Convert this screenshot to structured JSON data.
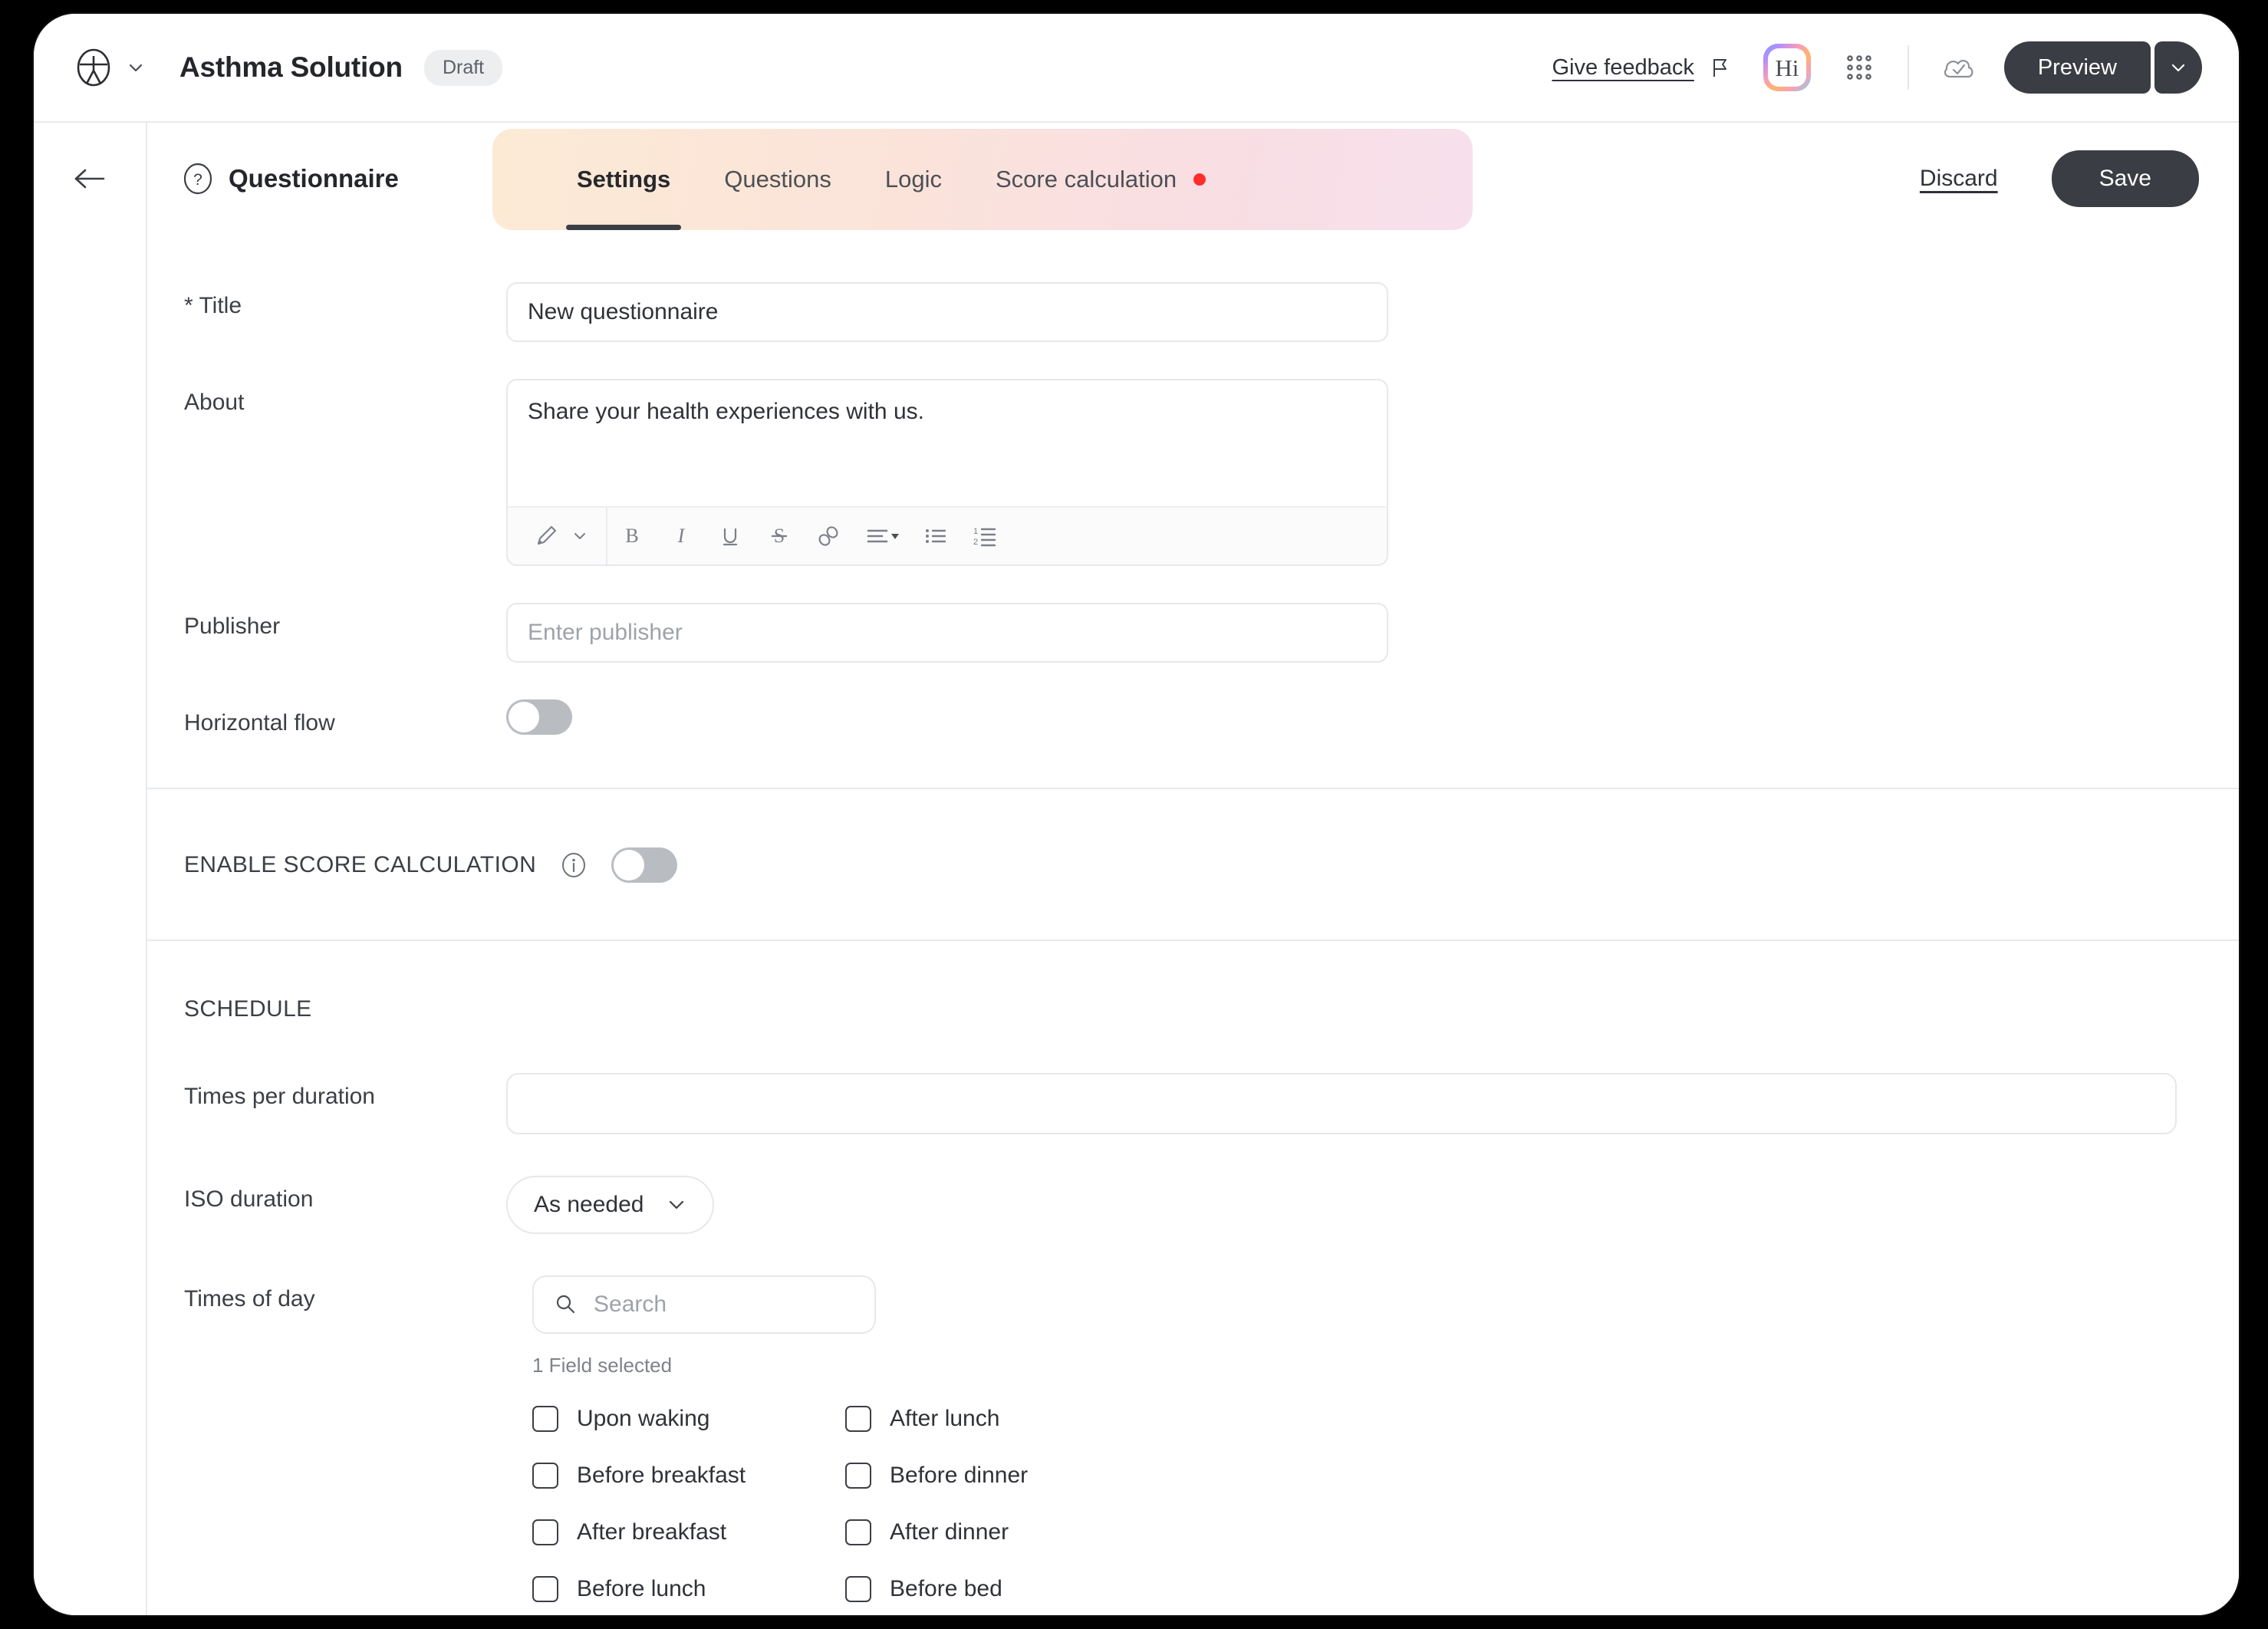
{
  "header": {
    "logo_icon": "accessibility-circle-logo",
    "logo_caret_icon": "chevron-down-icon",
    "app_title": "Asthma Solution",
    "status_badge": "Draft",
    "give_feedback": "Give feedback",
    "flag_icon": "flag-icon",
    "hi_badge": "Hi",
    "grid_icon": "apps-grid-icon",
    "cloud_icon": "cloud-check-icon",
    "preview_label": "Preview",
    "preview_caret_icon": "chevron-down-icon"
  },
  "subheader": {
    "back_icon": "arrow-left-icon",
    "section_icon": "question-circle-icon",
    "section_label": "Questionnaire",
    "tabs": [
      {
        "label": "Settings",
        "active": true,
        "dot": false
      },
      {
        "label": "Questions",
        "active": false,
        "dot": false
      },
      {
        "label": "Logic",
        "active": false,
        "dot": false
      },
      {
        "label": "Score calculation",
        "active": false,
        "dot": true
      }
    ],
    "dot_color": "#ff2d2d",
    "discard_label": "Discard",
    "save_label": "Save"
  },
  "form": {
    "title_label": "* Title",
    "title_value": "New questionnaire",
    "about_label": "About",
    "about_value": "Share your health experiences with us.",
    "editor_tools": [
      "pencil-icon",
      "chevron-down-icon",
      "bold-icon",
      "italic-icon",
      "underline-icon",
      "strikethrough-icon",
      "link-icon",
      "align-icon",
      "bullet-list-icon",
      "numbered-list-icon"
    ],
    "publisher_label": "Publisher",
    "publisher_placeholder": "Enter publisher",
    "publisher_value": "",
    "horizontal_flow_label": "Horizontal flow",
    "horizontal_flow_on": false
  },
  "score_section": {
    "label": "ENABLE SCORE CALCULATION",
    "info_icon": "info-icon",
    "enabled": false
  },
  "schedule": {
    "heading": "SCHEDULE",
    "times_per_duration_label": "Times per duration",
    "times_per_duration_value": "",
    "iso_duration_label": "ISO duration",
    "iso_duration_value": "As needed",
    "iso_duration_caret": "chevron-down-icon",
    "times_of_day_label": "Times of day",
    "search_icon": "search-icon",
    "search_placeholder": "Search",
    "search_value": "",
    "selected_count_text": "1 Field selected",
    "options": [
      {
        "label": "Upon waking",
        "checked": false
      },
      {
        "label": "After lunch",
        "checked": false
      },
      {
        "label": "Before breakfast",
        "checked": false
      },
      {
        "label": "Before dinner",
        "checked": false
      },
      {
        "label": "After breakfast",
        "checked": false
      },
      {
        "label": "After dinner",
        "checked": false
      },
      {
        "label": "Before lunch",
        "checked": false
      },
      {
        "label": "Before bed",
        "checked": false
      }
    ]
  }
}
